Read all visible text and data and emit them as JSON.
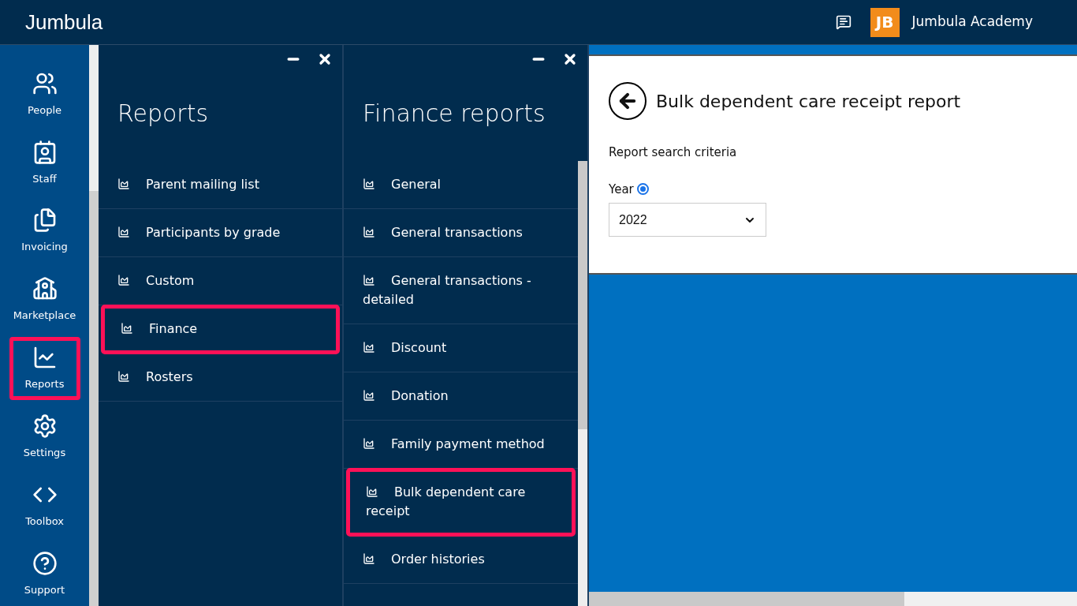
{
  "header": {
    "brand": "Jumbula",
    "logo_text": "JB",
    "account": "Jumbula Academy"
  },
  "sidebar": {
    "items": [
      {
        "label": "People",
        "highlighted": false
      },
      {
        "label": "Staff",
        "highlighted": false
      },
      {
        "label": "Invoicing",
        "highlighted": false
      },
      {
        "label": "Marketplace",
        "highlighted": false
      },
      {
        "label": "Reports",
        "highlighted": true
      },
      {
        "label": "Settings",
        "highlighted": false
      },
      {
        "label": "Toolbox",
        "highlighted": false
      },
      {
        "label": "Support",
        "highlighted": false
      }
    ]
  },
  "panels": [
    {
      "title": "Reports",
      "items": [
        {
          "label": "Parent mailing list",
          "highlighted": false
        },
        {
          "label": "Participants by grade",
          "highlighted": false
        },
        {
          "label": "Custom",
          "highlighted": false
        },
        {
          "label": "Finance",
          "highlighted": true
        },
        {
          "label": "Rosters",
          "highlighted": false
        }
      ]
    },
    {
      "title": "Finance reports",
      "items": [
        {
          "label": "General",
          "highlighted": false
        },
        {
          "label": "General transactions",
          "highlighted": false
        },
        {
          "label": "General transactions - detailed",
          "highlighted": false
        },
        {
          "label": "Discount",
          "highlighted": false
        },
        {
          "label": "Donation",
          "highlighted": false
        },
        {
          "label": "Family payment method",
          "highlighted": false
        },
        {
          "label": "Bulk dependent care receipt",
          "highlighted": true
        },
        {
          "label": "Order histories",
          "highlighted": false
        }
      ]
    }
  ],
  "report": {
    "title": "Bulk dependent care receipt report",
    "section": "Report search criteria",
    "year_label": "Year",
    "year_radio_checked": true,
    "year_value": "2022"
  }
}
